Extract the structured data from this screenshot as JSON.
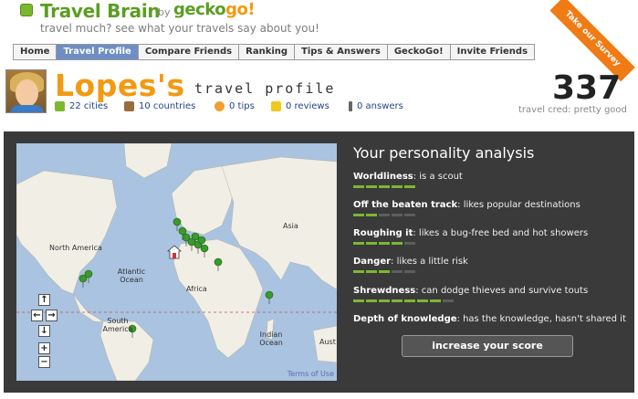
{
  "header": {
    "logo": "Travel Brain",
    "by": "by",
    "brand_a": "gecko",
    "brand_b": "go!",
    "tagline": "travel much? see what your travels say about you!",
    "ribbon": "Take our Survey"
  },
  "nav": {
    "tabs": [
      {
        "label": "Home",
        "active": false
      },
      {
        "label": "Travel Profile",
        "active": true
      },
      {
        "label": "Compare Friends",
        "active": false
      },
      {
        "label": "Ranking",
        "active": false
      },
      {
        "label": "Tips & Answers",
        "active": false
      },
      {
        "label": "GeckoGo!",
        "active": false
      },
      {
        "label": "Invite Friends",
        "active": false
      }
    ]
  },
  "profile": {
    "name": "Lopes's",
    "subtitle": "travel profile",
    "stats": {
      "cities": "22 cities",
      "countries": "10 countries",
      "tips": "0 tips",
      "reviews": "0 reviews",
      "answers": "0 answers"
    },
    "score": "337",
    "score_label": "travel cred: pretty good"
  },
  "map": {
    "labels": {
      "north_america": "North America",
      "atlantic": "Atlantic Ocean",
      "south_america": "South America",
      "africa": "Africa",
      "asia": "Asia",
      "indian": "Indian Ocean",
      "aust": "Aust"
    },
    "terms": "Terms of Use",
    "controls": {
      "up": "↑",
      "left": "←",
      "right": "→",
      "down": "↓",
      "zoom_in": "+",
      "zoom_out": "−"
    }
  },
  "analysis": {
    "title": "Your personality analysis",
    "traits": [
      {
        "name": "Worldliness",
        "desc": ": is a scout",
        "level": 5,
        "max": 5
      },
      {
        "name": "Off the beaten track",
        "desc": ": likes popular destinations",
        "level": 2,
        "max": 5
      },
      {
        "name": "Roughing it",
        "desc": ": likes a bug-free bed and hot showers",
        "level": 4,
        "max": 5
      },
      {
        "name": "Danger",
        "desc": ": likes a little risk",
        "level": 3,
        "max": 5
      },
      {
        "name": "Shrewdness",
        "desc": ": can dodge thieves and survive touts",
        "level": 7,
        "max": 8
      },
      {
        "name": "Depth of knowledge",
        "desc": ": has the knowledge, hasn't shared it",
        "level": 0,
        "max": 0
      }
    ],
    "button": "increase your score"
  },
  "colors": {
    "accent_green": "#7cb82f",
    "accent_orange": "#f29a12",
    "panel": "#3a3a3a",
    "tab_active": "#6f8fc4"
  }
}
